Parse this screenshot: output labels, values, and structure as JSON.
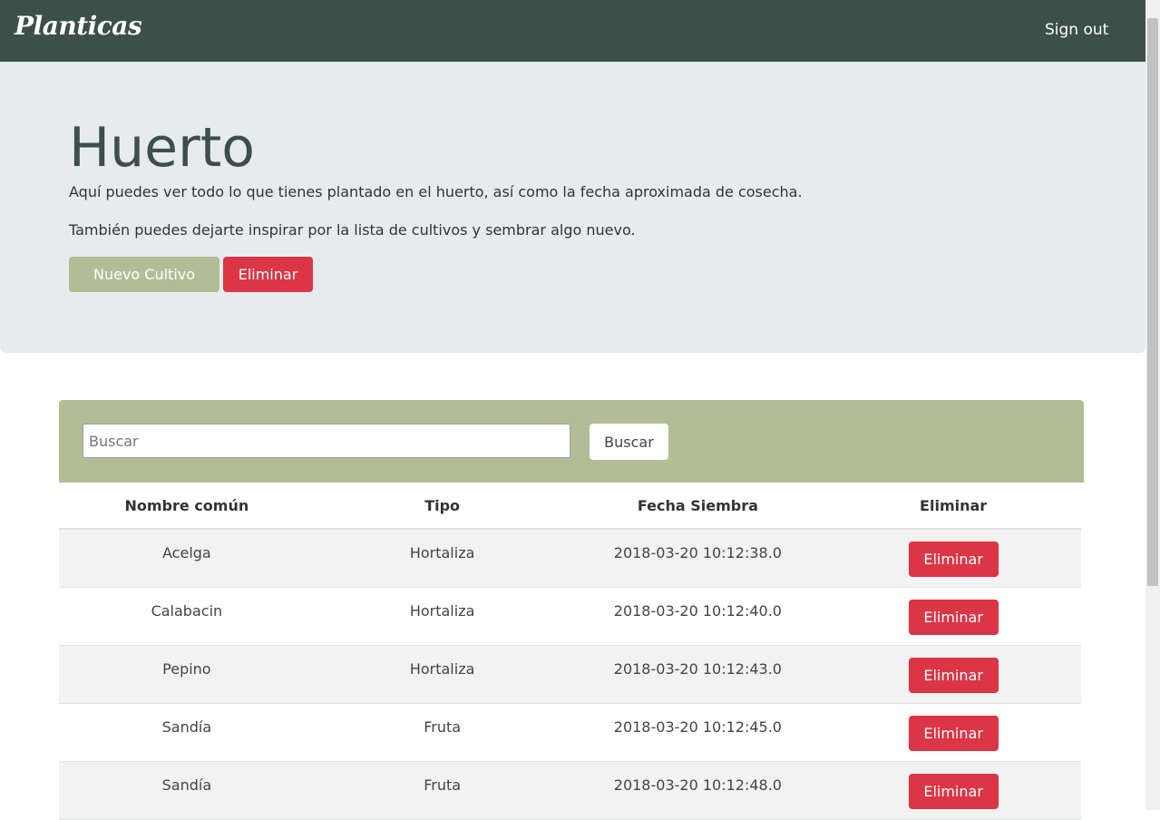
{
  "navbar": {
    "brand": "Planticas",
    "signout": "Sign out"
  },
  "hero": {
    "title": "Huerto",
    "lead1": "Aquí puedes ver todo lo que tienes plantado en el huerto, así como la fecha aproximada de cosecha.",
    "lead2": "También puedes dejarte inspirar por la lista de cultivos y sembrar algo nuevo.",
    "new_button": "Nuevo Cultivo",
    "delete_button": "Eliminar"
  },
  "search": {
    "placeholder": "Buscar",
    "value": "",
    "button": "Buscar"
  },
  "table": {
    "headers": [
      "Nombre común",
      "Tipo",
      "Fecha Siembra",
      "Eliminar"
    ],
    "rows": [
      {
        "name": "Acelga",
        "type": "Hortaliza",
        "date": "2018-03-20 10:12:38.0",
        "action": "Eliminar"
      },
      {
        "name": "Calabacin",
        "type": "Hortaliza",
        "date": "2018-03-20 10:12:40.0",
        "action": "Eliminar"
      },
      {
        "name": "Pepino",
        "type": "Hortaliza",
        "date": "2018-03-20 10:12:43.0",
        "action": "Eliminar"
      },
      {
        "name": "Sandía",
        "type": "Fruta",
        "date": "2018-03-20 10:12:45.0",
        "action": "Eliminar"
      },
      {
        "name": "Sandía",
        "type": "Fruta",
        "date": "2018-03-20 10:12:48.0",
        "action": "Eliminar"
      }
    ]
  },
  "colors": {
    "navbar": "#3c4f48",
    "jumbotron": "#e8ebee",
    "accent_green": "#b3bd95",
    "danger": "#dc3545"
  }
}
